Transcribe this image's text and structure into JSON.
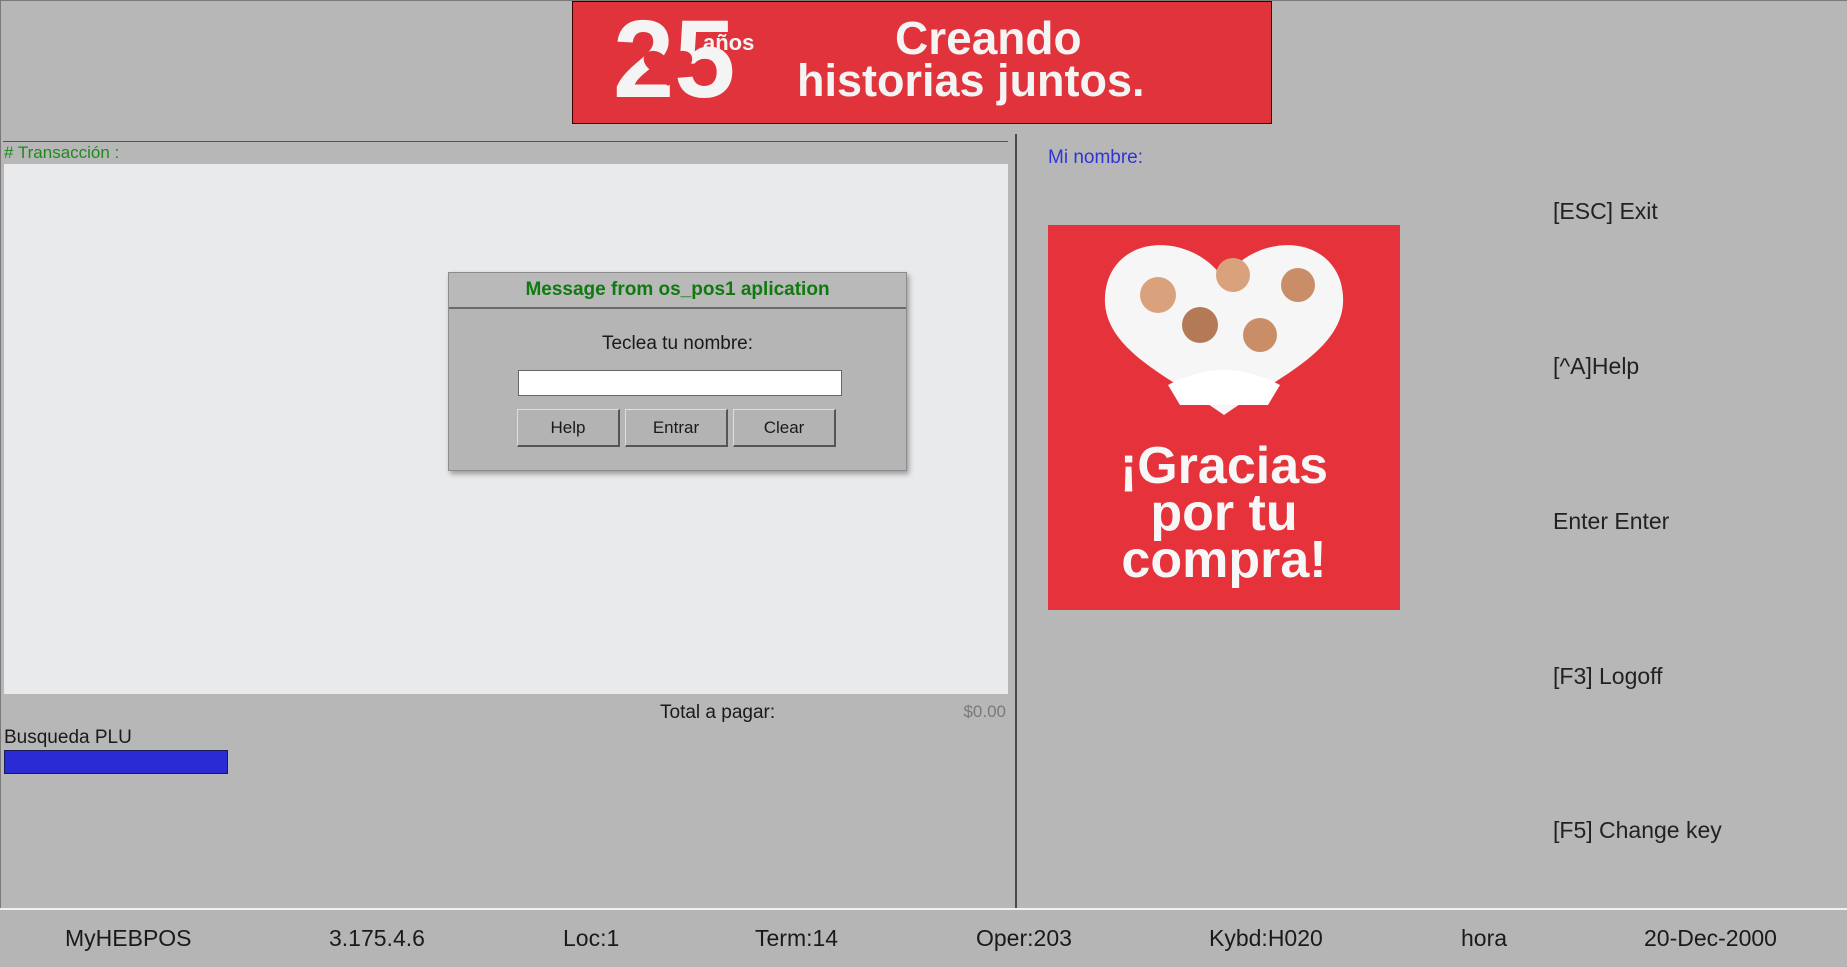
{
  "banner": {
    "years_number": "25",
    "years_word": "años",
    "line1": "Creando",
    "line2": "historias juntos."
  },
  "transaction": {
    "label": "# Transacción :"
  },
  "dialog": {
    "title": "Message from os_pos1 aplication",
    "prompt": "Teclea tu nombre:",
    "input_value": "",
    "buttons": {
      "help": "Help",
      "enter": "Entrar",
      "clear": "Clear"
    }
  },
  "totals": {
    "label": "Total a pagar:",
    "value": "$0.00"
  },
  "plu": {
    "label": "Busqueda PLU"
  },
  "right_panel": {
    "name_label": "Mi nombre:",
    "promo": {
      "line1": "¡Gracias",
      "line2": "por tu",
      "line3": "compra!"
    }
  },
  "function_keys": [
    {
      "label": "[ESC] Exit"
    },
    {
      "label": "[^A]Help"
    },
    {
      "label": "Enter Enter"
    },
    {
      "label": "[F3] Logoff"
    },
    {
      "label": "[F5] Change key"
    }
  ],
  "status_bar": {
    "app": "MyHEBPOS",
    "version": "3.175.4.6",
    "loc": "Loc:1",
    "term": "Term:14",
    "oper": "Oper:203",
    "kybd": "Kybd:H020",
    "time": "hora",
    "date": "20-Dec-2000"
  },
  "colors": {
    "background": "#b7b7b7",
    "brand_red": "#e0333b",
    "transaction_label_green": "#1e8a1e",
    "dialog_title_green": "#0f7a0f",
    "name_label_blue": "#2f34d8",
    "plu_bar_blue": "#2b2bd6",
    "panel_white": "#e9eaec"
  }
}
